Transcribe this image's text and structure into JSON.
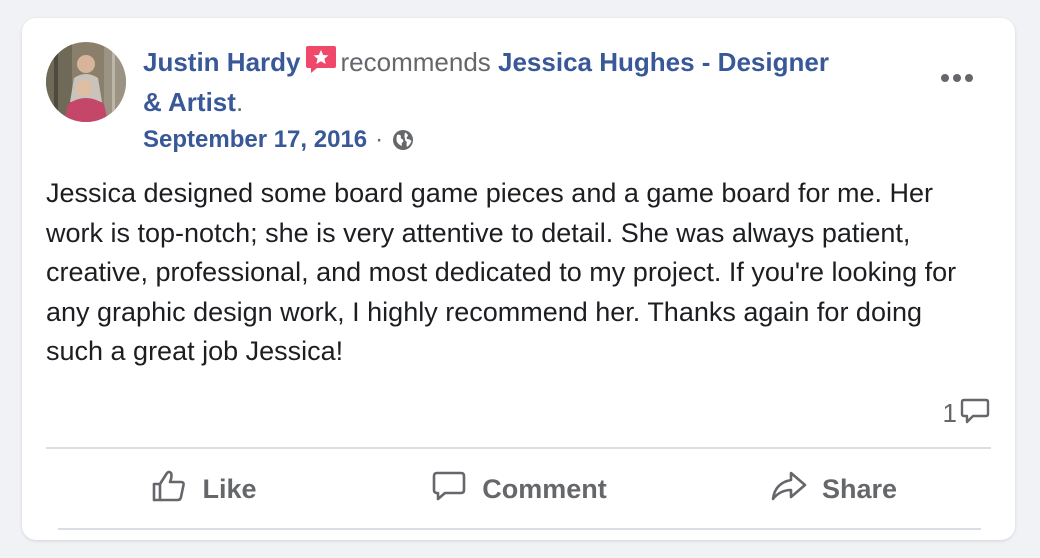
{
  "post": {
    "author": "Justin Hardy",
    "action_text": "recommends",
    "page_name": "Jessica Hughes - Designer & Artist",
    "punct": ".",
    "date": "September 17, 2016",
    "separator": "·",
    "audience_icon": "globe-icon",
    "badge_icon": "recommendation-star-icon",
    "menu_icon": "more-options-icon",
    "body": "Jessica designed some board game pieces and a game board for me. Her work is top-notch; she is very attentive to detail. She was always patient, creative, professional, and most dedicated to my project. If you're looking for any graphic design work, I highly recommend her. Thanks again for doing such a great job Jessica!",
    "comment_count": "1"
  },
  "actions": {
    "like": "Like",
    "comment": "Comment",
    "share": "Share"
  },
  "colors": {
    "link": "#385898",
    "secondary_text": "#65676b",
    "body_text": "#1c1e21",
    "badge": "#f0486a"
  }
}
